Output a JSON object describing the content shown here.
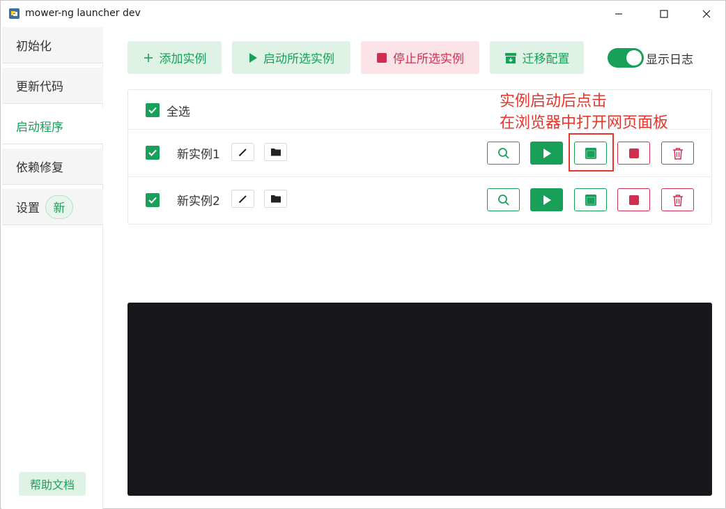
{
  "window": {
    "title": "mower-ng launcher dev"
  },
  "sidebar": {
    "items": [
      {
        "label": "初始化",
        "active": false
      },
      {
        "label": "更新代码",
        "active": false
      },
      {
        "label": "启动程序",
        "active": true
      },
      {
        "label": "依赖修复",
        "active": false
      },
      {
        "label": "设置",
        "active": false,
        "badge": "新"
      }
    ],
    "help_label": "帮助文档"
  },
  "toolbar": {
    "add_label": "添加实例",
    "start_selected_label": "启动所选实例",
    "stop_selected_label": "停止所选实例",
    "migrate_label": "迁移配置",
    "show_log_label": "显示日志",
    "show_log_on": true
  },
  "instances": {
    "select_all_label": "全选",
    "rows": [
      {
        "name": "新实例1",
        "checked": true
      },
      {
        "name": "新实例2",
        "checked": true
      }
    ]
  },
  "annotation": {
    "line1": "实例启动后点击",
    "line2": "在浏览器中打开网页面板"
  },
  "colors": {
    "accent_green": "#18a058",
    "danger_red": "#d03050",
    "annotation_red": "#e8352b",
    "log_bg": "#18181c"
  }
}
